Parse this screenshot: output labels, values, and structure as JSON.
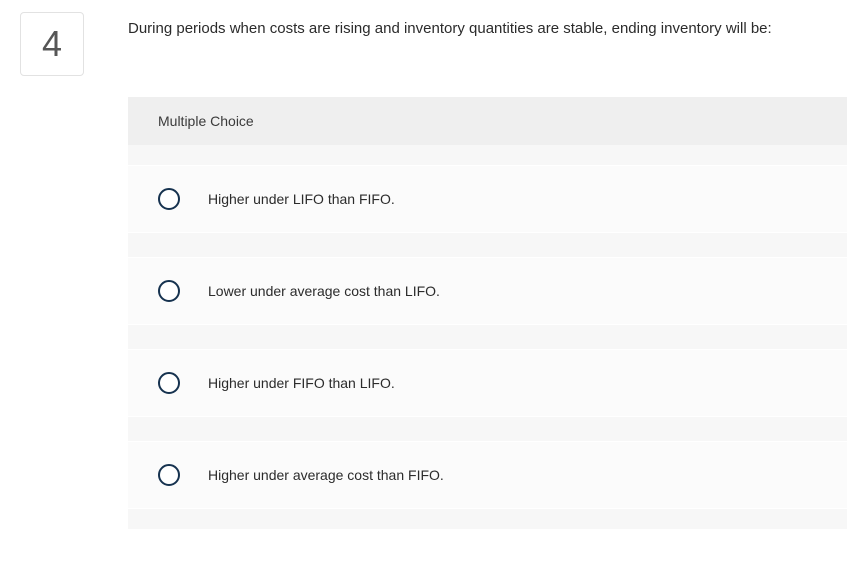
{
  "question": {
    "number": "4",
    "text": "During periods when costs are rising and inventory quantities are stable, ending inventory will be:"
  },
  "mc": {
    "header": "Multiple Choice",
    "options": [
      "Higher under LIFO than FIFO.",
      "Lower under average cost than LIFO.",
      "Higher under FIFO than LIFO.",
      "Higher under average cost than FIFO."
    ]
  }
}
